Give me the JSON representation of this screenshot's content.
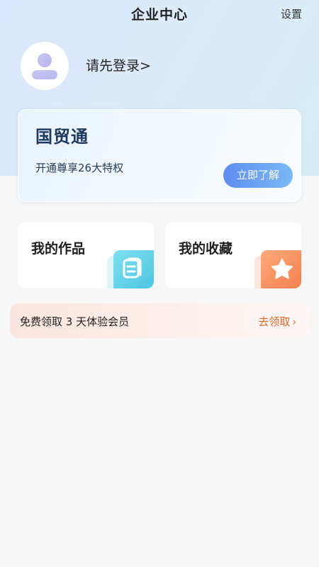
{
  "header": {
    "title": "企业中心",
    "settings_label": "设置"
  },
  "profile": {
    "login_prompt": "请先登录>"
  },
  "vip_card": {
    "title": "国贸通",
    "description": "开通尊享26大特权",
    "button_label": "立即了解"
  },
  "tiles": [
    {
      "label": "我的作品",
      "icon": "document-icon",
      "color": "#5fcfe6"
    },
    {
      "label": "我的收藏",
      "icon": "star-icon",
      "color": "#f7895a"
    }
  ],
  "trial": {
    "text": "免费领取 3 天体验会员",
    "cta_label": "去领取",
    "accent": "#e06a2a"
  }
}
